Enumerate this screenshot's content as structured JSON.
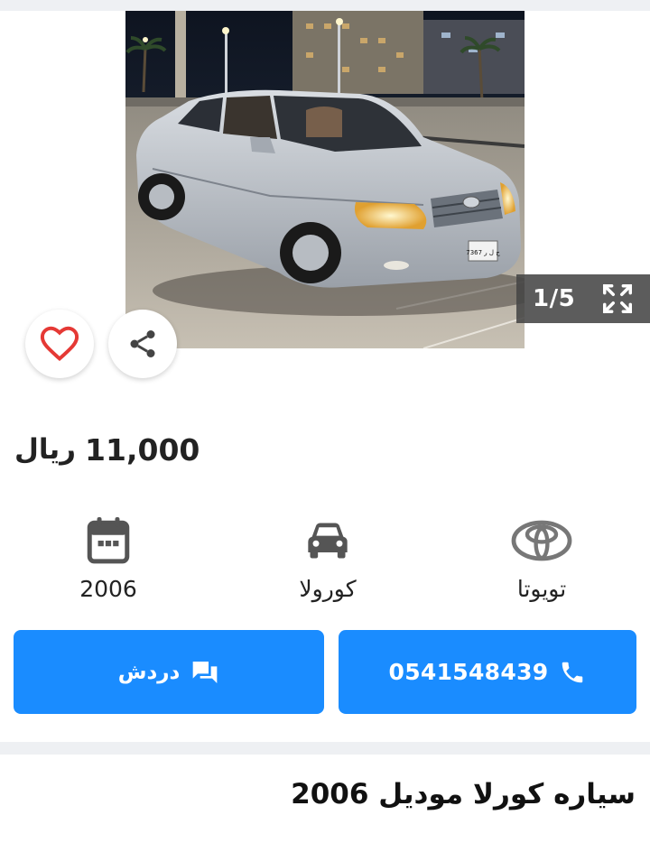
{
  "gallery": {
    "counter": "1/5",
    "plate": "ح ل ر 7367",
    "icons": {
      "prev": "chevron-left-icon",
      "next": "chevron-right-icon",
      "expand": "fullscreen-icon",
      "favorite": "heart-icon",
      "share": "share-icon"
    }
  },
  "listing": {
    "price": "11,000",
    "currency": "ريال",
    "title": "سياره كورلا موديل 2006"
  },
  "specs": {
    "year": "2006",
    "model": "كورولا",
    "make": "تويوتا"
  },
  "actions": {
    "chat_label": "دردش",
    "phone": "0541548439"
  },
  "colors": {
    "primary": "#1a8cff",
    "heart": "#e53935",
    "separator": "#eef0f3"
  }
}
